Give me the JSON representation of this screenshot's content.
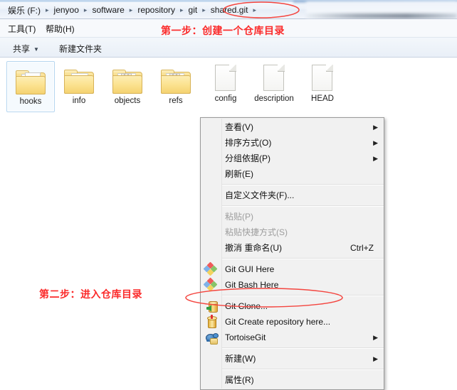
{
  "window": {
    "addressbar": {
      "crumbs": [
        "娱乐 (F:)",
        "jenyoo",
        "software",
        "repository",
        "git",
        "shared.git"
      ],
      "separator": "▸"
    },
    "menubar": {
      "items": [
        {
          "label": "工具(T)"
        },
        {
          "label": "帮助(H)"
        }
      ]
    },
    "commandbar": {
      "share_label": "共享",
      "share_caret": "▼",
      "new_folder_label": "新建文件夹"
    }
  },
  "files": [
    {
      "name": "hooks",
      "type": "folder",
      "variant": "papers",
      "selected": true
    },
    {
      "name": "info",
      "type": "folder",
      "variant": "paper",
      "selected": false
    },
    {
      "name": "objects",
      "type": "folder",
      "variant": "spines",
      "selected": false
    },
    {
      "name": "refs",
      "type": "folder",
      "variant": "spines",
      "selected": false
    },
    {
      "name": "config",
      "type": "file",
      "selected": false
    },
    {
      "name": "description",
      "type": "file",
      "selected": false
    },
    {
      "name": "HEAD",
      "type": "file",
      "selected": false
    }
  ],
  "context_menu": {
    "items": [
      {
        "label": "查看(V)",
        "icon": null,
        "submenu": true,
        "accel": null,
        "disabled": false,
        "sep_after": false
      },
      {
        "label": "排序方式(O)",
        "icon": null,
        "submenu": true,
        "accel": null,
        "disabled": false,
        "sep_after": false
      },
      {
        "label": "分组依据(P)",
        "icon": null,
        "submenu": true,
        "accel": null,
        "disabled": false,
        "sep_after": false
      },
      {
        "label": "刷新(E)",
        "icon": null,
        "submenu": false,
        "accel": null,
        "disabled": false,
        "sep_after": true
      },
      {
        "label": "自定义文件夹(F)...",
        "icon": null,
        "submenu": false,
        "accel": null,
        "disabled": false,
        "sep_after": true
      },
      {
        "label": "粘贴(P)",
        "icon": null,
        "submenu": false,
        "accel": null,
        "disabled": true,
        "sep_after": false
      },
      {
        "label": "粘贴快捷方式(S)",
        "icon": null,
        "submenu": false,
        "accel": null,
        "disabled": true,
        "sep_after": false
      },
      {
        "label": "撤消 重命名(U)",
        "icon": null,
        "submenu": false,
        "accel": "Ctrl+Z",
        "disabled": false,
        "sep_after": true
      },
      {
        "label": "Git GUI Here",
        "icon": "git-gui-icon",
        "submenu": false,
        "accel": null,
        "disabled": false,
        "sep_after": false
      },
      {
        "label": "Git Bash Here",
        "icon": "git-bash-icon",
        "submenu": false,
        "accel": null,
        "disabled": false,
        "sep_after": true
      },
      {
        "label": "Git Clone...",
        "icon": "git-clone-icon",
        "submenu": false,
        "accel": null,
        "disabled": false,
        "sep_after": false
      },
      {
        "label": "Git Create repository here...",
        "icon": "git-create-repository-icon",
        "submenu": false,
        "accel": null,
        "disabled": false,
        "sep_after": false
      },
      {
        "label": "TortoiseGit",
        "icon": "tortoisegit-icon",
        "submenu": true,
        "accel": null,
        "disabled": false,
        "sep_after": true
      },
      {
        "label": "新建(W)",
        "icon": null,
        "submenu": true,
        "accel": null,
        "disabled": false,
        "sep_after": true
      },
      {
        "label": "属性(R)",
        "icon": null,
        "submenu": false,
        "accel": null,
        "disabled": false,
        "sep_after": false
      }
    ]
  },
  "annotations": {
    "step1": "第一步：创建一个仓库目录",
    "step2": "第二步：进入仓库目录",
    "color": "#fb2a2a"
  }
}
